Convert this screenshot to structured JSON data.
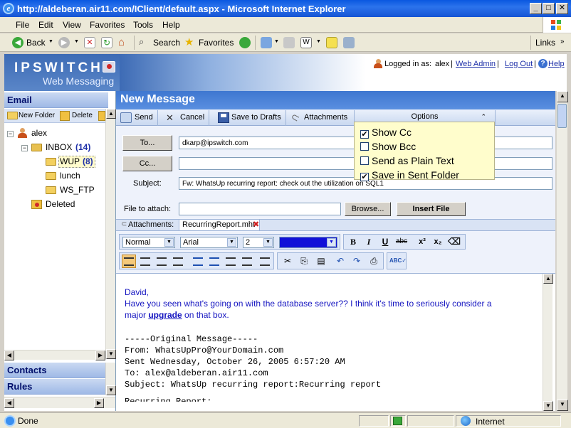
{
  "window": {
    "title": "http://aldeberan.air11.com/IClient/default.aspx - Microsoft Internet Explorer",
    "ie_icon": "e"
  },
  "menu": [
    "File",
    "Edit",
    "View",
    "Favorites",
    "Tools",
    "Help"
  ],
  "toolbar": {
    "back": "Back",
    "search": "Search",
    "favorites": "Favorites",
    "links": "Links"
  },
  "header": {
    "logo": "IPSWITCH",
    "product": "Web Messaging",
    "logged_in_label": "Logged in as:",
    "user": "alex",
    "web_admin": "Web Admin",
    "log_out": "Log Out",
    "help": "Help"
  },
  "left": {
    "email_header": "Email",
    "new_folder": "New Folder",
    "delete": "Delete",
    "tree": {
      "root": "alex",
      "inbox": "INBOX",
      "inbox_count": "(14)",
      "wup": "WUP",
      "wup_count": "(8)",
      "lunch": "lunch",
      "ws_ftp": "WS_FTP",
      "deleted": "Deleted"
    },
    "contacts": "Contacts",
    "rules": "Rules"
  },
  "compose": {
    "title": "New Message",
    "toolbar": {
      "send": "Send",
      "cancel": "Cancel",
      "save_drafts": "Save to Drafts",
      "attachments": "Attachments",
      "options": "Options"
    },
    "options": [
      {
        "label": "Show Cc",
        "checked": "✔"
      },
      {
        "label": "Show Bcc",
        "checked": ""
      },
      {
        "label": "Send as Plain Text",
        "checked": ""
      },
      {
        "label": "Save in Sent Folder",
        "checked": "✔"
      }
    ],
    "to_button": "To...",
    "cc_button": "Cc...",
    "to_value": "dkarp@ipswitch.com",
    "cc_value": "",
    "subject_label": "Subject:",
    "subject_value": "Fw: WhatsUp recurring report: check out the utilization on SQL1",
    "file_label": "File to attach:",
    "browse": "Browse...",
    "insert_file": "Insert File",
    "attachments_label": "Attachments:",
    "attachment_file": "RecurringReport.mht"
  },
  "editor": {
    "style": "Normal",
    "font": "Arial",
    "size": "2",
    "color": "Blue",
    "bold": "B",
    "italic": "I",
    "underline": "U",
    "strike": "abc",
    "superscript": "x²",
    "subscript": "x₂"
  },
  "message": {
    "greeting": "David,",
    "line1": "Have you seen what's going on with the database server??  I think it's time to seriously consider a",
    "line2_pre": "major ",
    "line2_link": "upgrade",
    "line2_post": " on that box.",
    "orig_header": "-----Original Message-----",
    "from": "From: WhatsUpPro@YourDomain.com",
    "sent": "Sent Wednesday, October 26, 2005 6:57:20 AM",
    "to": "To: alex@aldeberan.air11.com",
    "subject": "Subject: WhatsUp recurring report:Recurring report",
    "partial": "Recurring Report:"
  },
  "status": {
    "text": "Done",
    "zone": "Internet"
  },
  "colors": {
    "xp_blue": "#0a58e0",
    "pane_blue": "#3e77d0",
    "popup_yellow": "#fffdcc",
    "link_blue": "#1414c0"
  }
}
